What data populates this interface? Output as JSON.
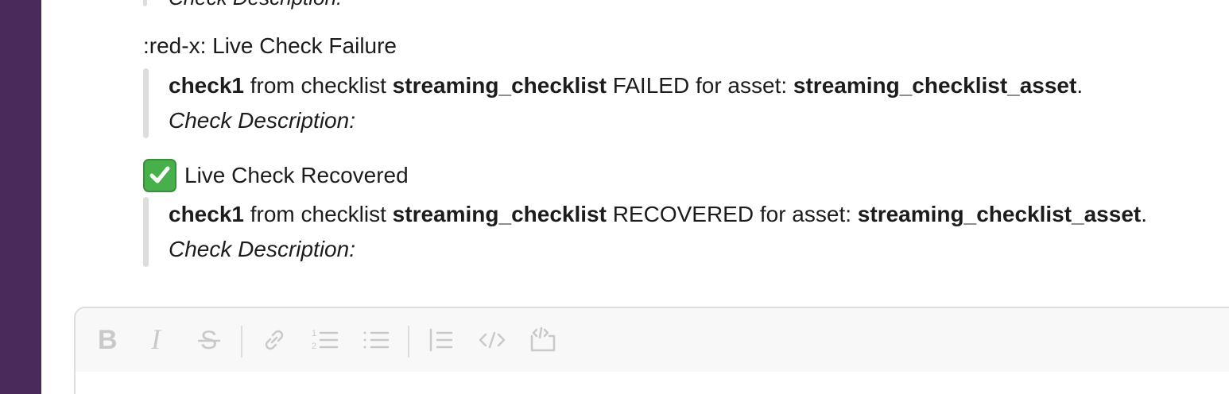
{
  "sidebar": {
    "color": "#4a2a5a"
  },
  "previous_message": {
    "partial_text": "Check Description:"
  },
  "messages": [
    {
      "title": ":red-x: Live Check Failure",
      "check_name": "check1",
      "from_text": " from checklist ",
      "checklist_name": "streaming_checklist",
      "status_text": " FAILED for asset: ",
      "asset_name": "streaming_checklist_asset",
      "end_punct": ".",
      "description_label": "Check Description:"
    },
    {
      "title": "Live Check Recovered",
      "emoji": "white-check-mark-icon",
      "check_name": "check1",
      "from_text": " from checklist ",
      "checklist_name": "streaming_checklist",
      "status_text": " RECOVERED for asset: ",
      "asset_name": "streaming_checklist_asset",
      "end_punct": ".",
      "description_label": "Check Description:"
    }
  ],
  "composer": {
    "toolbar": [
      "bold-icon",
      "italic-icon",
      "strikethrough-icon",
      "link-icon",
      "ordered-list-icon",
      "bulleted-list-icon",
      "blockquote-icon",
      "code-icon",
      "code-block-icon"
    ]
  }
}
